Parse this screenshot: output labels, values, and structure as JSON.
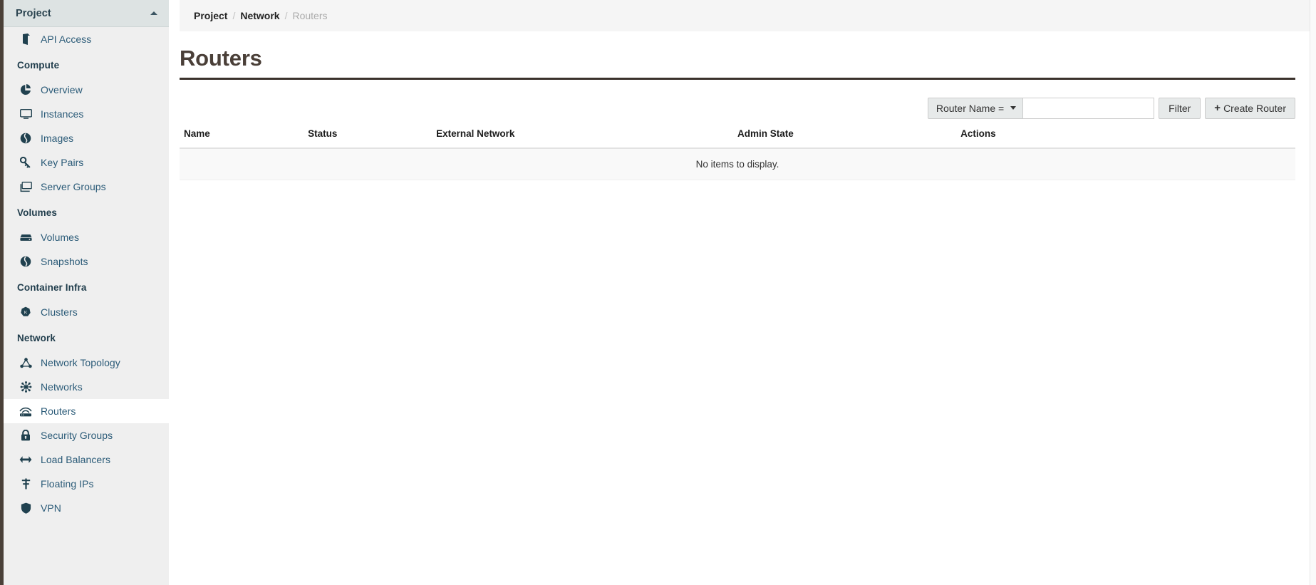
{
  "sidebar": {
    "panel_title": "Project",
    "collapse_icon": "caret-up-icon",
    "groups": [
      {
        "label": "",
        "items": [
          {
            "label": "API Access",
            "icon": "api-access-icon",
            "active": false
          }
        ]
      },
      {
        "label": "Compute",
        "items": [
          {
            "label": "Overview",
            "icon": "pie-chart-icon",
            "active": false
          },
          {
            "label": "Instances",
            "icon": "monitor-icon",
            "active": false
          },
          {
            "label": "Images",
            "icon": "images-icon",
            "active": false
          },
          {
            "label": "Key Pairs",
            "icon": "key-icon",
            "active": false
          },
          {
            "label": "Server Groups",
            "icon": "server-groups-icon",
            "active": false
          }
        ]
      },
      {
        "label": "Volumes",
        "items": [
          {
            "label": "Volumes",
            "icon": "volume-icon",
            "active": false
          },
          {
            "label": "Snapshots",
            "icon": "snapshot-icon",
            "active": false
          }
        ]
      },
      {
        "label": "Container Infra",
        "items": [
          {
            "label": "Clusters",
            "icon": "kubernetes-cluster-icon",
            "active": false
          }
        ]
      },
      {
        "label": "Network",
        "items": [
          {
            "label": "Network Topology",
            "icon": "network-topology-icon",
            "active": false
          },
          {
            "label": "Networks",
            "icon": "networks-icon",
            "active": false
          },
          {
            "label": "Routers",
            "icon": "router-icon",
            "active": true
          },
          {
            "label": "Security Groups",
            "icon": "lock-icon",
            "active": false
          },
          {
            "label": "Load Balancers",
            "icon": "load-balancer-icon",
            "active": false
          },
          {
            "label": "Floating IPs",
            "icon": "floating-ip-icon",
            "active": false
          },
          {
            "label": "VPN",
            "icon": "shield-icon",
            "active": false
          }
        ]
      }
    ]
  },
  "breadcrumb": {
    "items": [
      "Project",
      "Network",
      "Routers"
    ],
    "separator": "/"
  },
  "page": {
    "title": "Routers"
  },
  "toolbar": {
    "filter_select_label": "Router Name =",
    "filter_select_icon": "chevron-down-icon",
    "filter_input_value": "",
    "filter_input_placeholder": "",
    "filter_button_label": "Filter",
    "create_button_label": "Create Router",
    "create_button_icon": "plus-icon"
  },
  "table": {
    "columns": [
      "Name",
      "Status",
      "External Network",
      "Admin State",
      "Actions"
    ],
    "rows": [],
    "empty_message": "No items to display."
  },
  "colors": {
    "sidebar_bg": "#efefef",
    "sidebar_header_bg": "#dde3e3",
    "sidebar_edge": "#4a4038",
    "active_border": "#27424f",
    "link_text": "#2b5b78",
    "page_title": "#4a3f38",
    "rule": "#3b322c",
    "breadcrumb_bg": "#f5f5f5",
    "button_bg": "#e7eaea"
  }
}
